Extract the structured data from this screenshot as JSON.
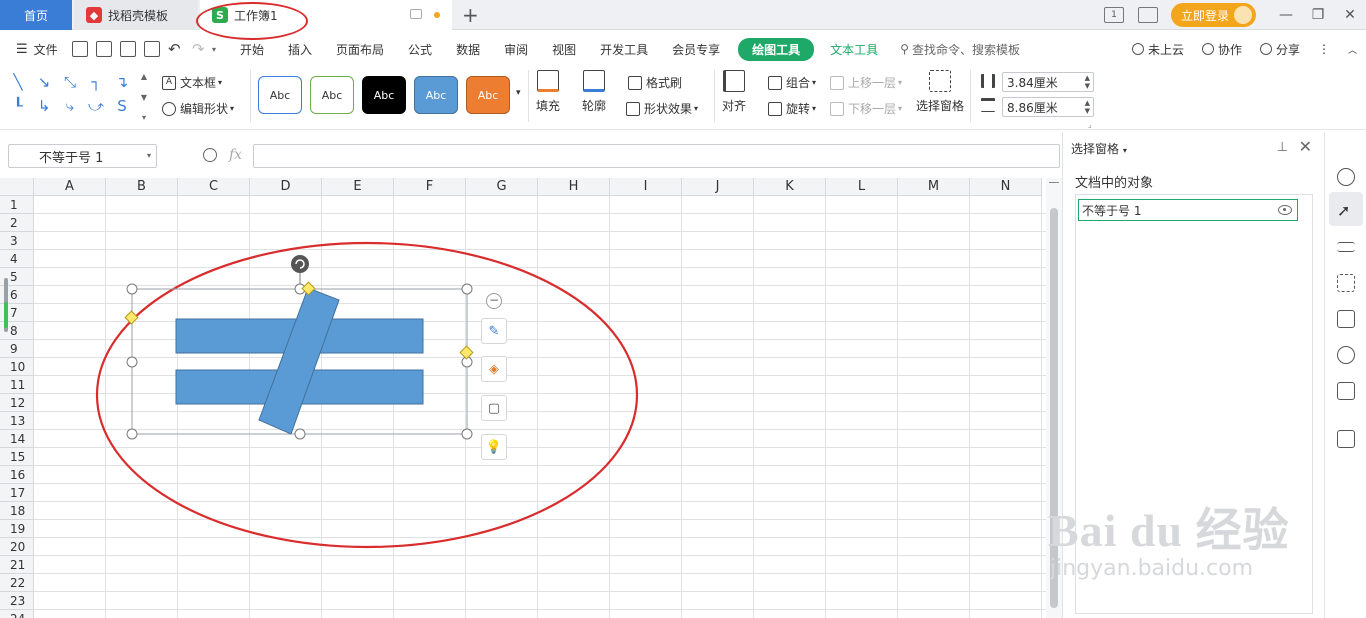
{
  "titlebar": {
    "home_tab": "首页",
    "docer_tab": "找稻壳模板",
    "docer_icon": "docer-icon",
    "workbook_tab": "工作簿1",
    "workbook_icon": "S",
    "login_button": "立即登录",
    "layout_badge": "1"
  },
  "menu": {
    "file": "文件",
    "items": [
      "开始",
      "插入",
      "页面布局",
      "公式",
      "数据",
      "审阅",
      "视图",
      "开发工具",
      "会员专享"
    ],
    "drawing_tools": "绘图工具",
    "text_tools": "文本工具",
    "search": "查找命令、搜索模板",
    "cloud": "未上云",
    "collab": "协作",
    "share": "分享"
  },
  "ribbon": {
    "textbox": "文本框",
    "edit_shape": "编辑形状",
    "style_label": "Abc",
    "styles": [
      {
        "bg": "#ffffff",
        "border": "#3a7dd6",
        "color": "#333333"
      },
      {
        "bg": "#ffffff",
        "border": "#70ad47",
        "color": "#333333"
      },
      {
        "bg": "#000000",
        "border": "#000000",
        "color": "#ffffff"
      },
      {
        "bg": "#5b9bd5",
        "border": "#41719c",
        "color": "#ffffff"
      },
      {
        "bg": "#ed7d31",
        "border": "#ae5a21",
        "color": "#ffffff"
      }
    ],
    "fill": "填充",
    "outline": "轮廓",
    "format_painter": "格式刷",
    "shape_effect": "形状效果",
    "align": "对齐",
    "group": "组合",
    "rotate": "旋转",
    "bring_forward": "上移一层",
    "send_backward": "下移一层",
    "selection_pane": "选择窗格",
    "height_value": "3.84厘米",
    "width_value": "8.86厘米"
  },
  "formula_bar": {
    "name_box": "不等于号 1",
    "fx": "fx",
    "formula": ""
  },
  "sheet": {
    "columns": [
      "A",
      "B",
      "C",
      "D",
      "E",
      "F",
      "G",
      "H",
      "I",
      "J",
      "K",
      "L",
      "M",
      "N"
    ],
    "rows": [
      "1",
      "2",
      "3",
      "4",
      "5",
      "6",
      "7",
      "8",
      "9",
      "10",
      "11",
      "12",
      "13",
      "14",
      "15",
      "16",
      "17",
      "18",
      "19",
      "20",
      "21",
      "22",
      "23",
      "24"
    ]
  },
  "shape": {
    "name": "不等于号 1",
    "fill_color": "#5b9bd5",
    "stroke_color": "#41719c"
  },
  "pane": {
    "title": "选择窗格",
    "subtitle": "文档中的对象",
    "objects": [
      "不等于号 1"
    ]
  },
  "annotation_color": "#d92d2d",
  "watermark": {
    "main": "Bai du 经验",
    "sub": "jingyan.baidu.com"
  }
}
